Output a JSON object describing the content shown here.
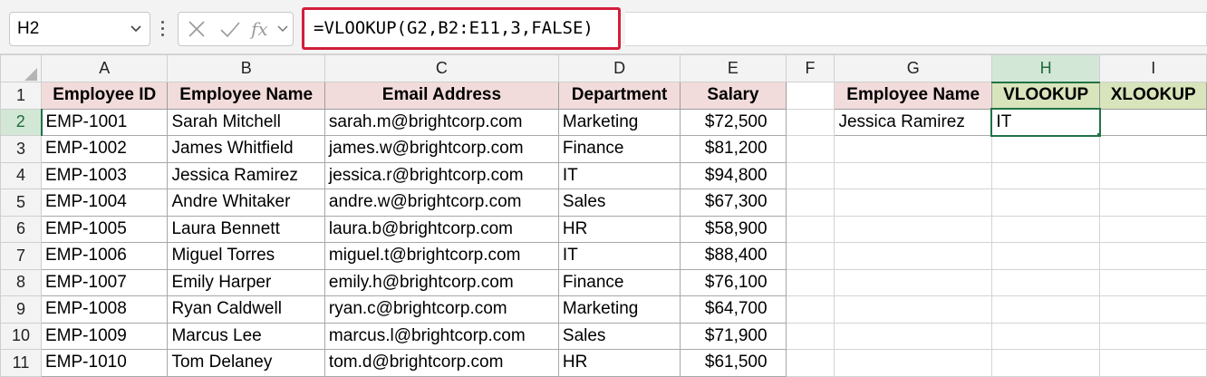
{
  "namebox": {
    "value": "H2",
    "icon": "chevron-down-icon"
  },
  "formula_bar": {
    "cancel_icon": "close-icon",
    "enter_icon": "check-icon",
    "fx_label": "fx",
    "formula": "=VLOOKUP(G2,B2:E11,3,FALSE)"
  },
  "columns": [
    "A",
    "B",
    "C",
    "D",
    "E",
    "F",
    "G",
    "H",
    "I"
  ],
  "selected_cell": "H2",
  "headers": [
    "Employee ID",
    "Employee Name",
    "Email Address",
    "Department",
    "Salary"
  ],
  "rows": [
    [
      "EMP-1001",
      "Sarah Mitchell",
      "sarah.m@brightcorp.com",
      "Marketing",
      "$72,500"
    ],
    [
      "EMP-1002",
      "James Whitfield",
      "james.w@brightcorp.com",
      "Finance",
      "$81,200"
    ],
    [
      "EMP-1003",
      "Jessica Ramirez",
      "jessica.r@brightcorp.com",
      "IT",
      "$94,800"
    ],
    [
      "EMP-1004",
      "Andre Whitaker",
      "andre.w@brightcorp.com",
      "Sales",
      "$67,300"
    ],
    [
      "EMP-1005",
      "Laura Bennett",
      "laura.b@brightcorp.com",
      "HR",
      "$58,900"
    ],
    [
      "EMP-1006",
      "Miguel Torres",
      "miguel.t@brightcorp.com",
      "IT",
      "$88,400"
    ],
    [
      "EMP-1007",
      "Emily Harper",
      "emily.h@brightcorp.com",
      "Finance",
      "$76,100"
    ],
    [
      "EMP-1008",
      "Ryan Caldwell",
      "ryan.c@brightcorp.com",
      "Marketing",
      "$64,700"
    ],
    [
      "EMP-1009",
      "Marcus Lee",
      "marcus.l@brightcorp.com",
      "Sales",
      "$71,900"
    ],
    [
      "EMP-1010",
      "Tom Delaney",
      "tom.d@brightcorp.com",
      "HR",
      "$61,500"
    ]
  ],
  "lookup": {
    "headers": [
      "Employee Name",
      "VLOOKUP",
      "XLOOKUP"
    ],
    "values": [
      "Jessica Ramirez",
      "IT",
      ""
    ]
  },
  "colors": {
    "pink_header": "#f2dcdb",
    "green_header": "#d8e4bc",
    "selection": "#217346",
    "formula_highlight": "#d21f3c"
  }
}
